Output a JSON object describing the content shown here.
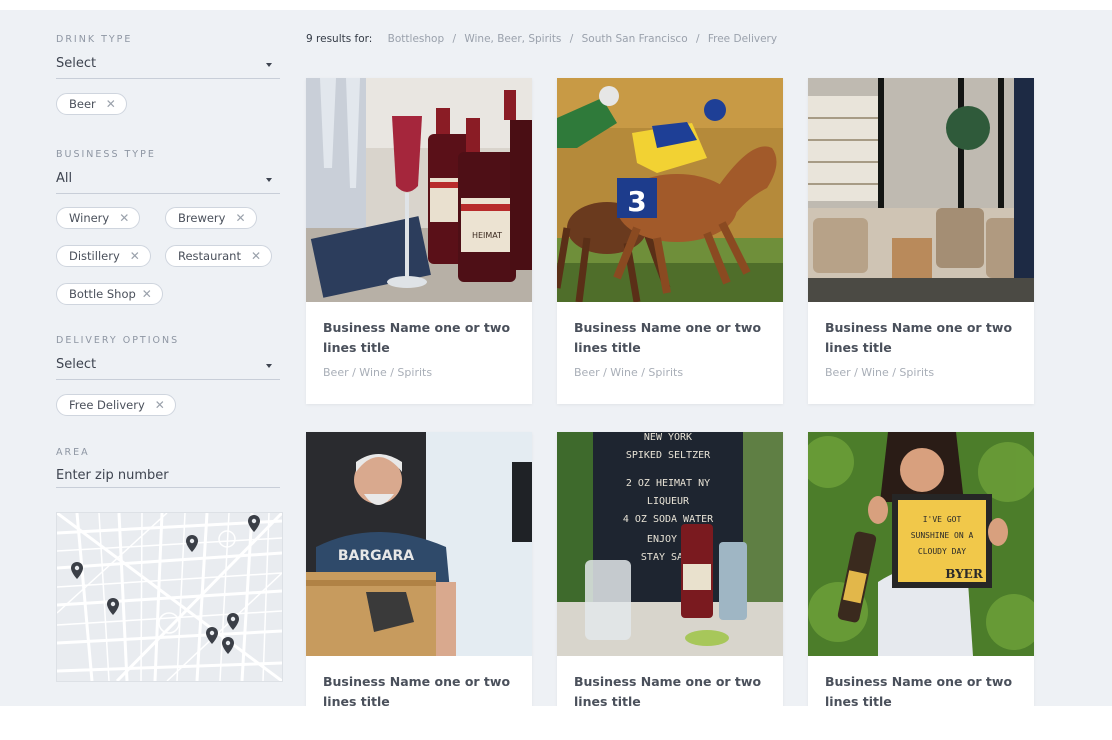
{
  "filters": {
    "drink_type": {
      "label": "DRINK TYPE",
      "selected": "Select",
      "chips": [
        "Beer"
      ]
    },
    "business_type": {
      "label": "BUSINESS TYPE",
      "selected": "All",
      "chips": [
        "Winery",
        "Brewery",
        "Distillery",
        "Restaurant",
        "Bottle Shop"
      ]
    },
    "delivery_options": {
      "label": "DELIVERY OPTIONS",
      "selected": "Select",
      "chips": [
        "Free Delivery"
      ]
    },
    "area": {
      "label": "AREA",
      "placeholder": "Enter zip number"
    }
  },
  "results": {
    "count_text": "9 results for:",
    "breadcrumbs": [
      "Bottleshop",
      "Wine, Beer, Spirits",
      "South San Francisco",
      "Free Delivery"
    ],
    "separator": "/"
  },
  "cards": [
    {
      "title": "Business Name one or two lines title",
      "tags": "Beer / Wine / Spirits",
      "image": "wine-bottles-photo"
    },
    {
      "title": "Business Name one or two lines title",
      "tags": "Beer / Wine / Spirits",
      "image": "horse-racing-photo"
    },
    {
      "title": "Business Name one or two lines title",
      "tags": "Beer / Wine / Spirits",
      "image": "lounge-interior-photo"
    },
    {
      "title": "Business Name one or two lines title",
      "tags": "",
      "image": "man-with-box-photo"
    },
    {
      "title": "Business Name one or two lines title",
      "tags": "",
      "image": "seltzer-board-photo"
    },
    {
      "title": "Business Name one or two lines title",
      "tags": "",
      "image": "woman-with-sign-photo"
    }
  ],
  "photo_text": {
    "jersey_number": "3",
    "shirt_brand": "BARGARA",
    "board_lines": [
      "NEW YORK",
      "SPIKED SELTZER",
      "2 OZ HEIMAT NY",
      "LIQUEUR",
      "4 OZ SODA WATER",
      "ENJOY &",
      "STAY SAFE"
    ],
    "sign_lines": [
      "I'VE GOT",
      "SUNSHINE ON A",
      "CLOUDY DAY"
    ],
    "sign_logo": "BYER",
    "bottle_label": "HEIMAT"
  },
  "colors": {
    "page_bg": "#eef1f5",
    "card_bg": "#ffffff",
    "map_pin": "#3b3f47",
    "muted_text": "#9aa1ac"
  }
}
